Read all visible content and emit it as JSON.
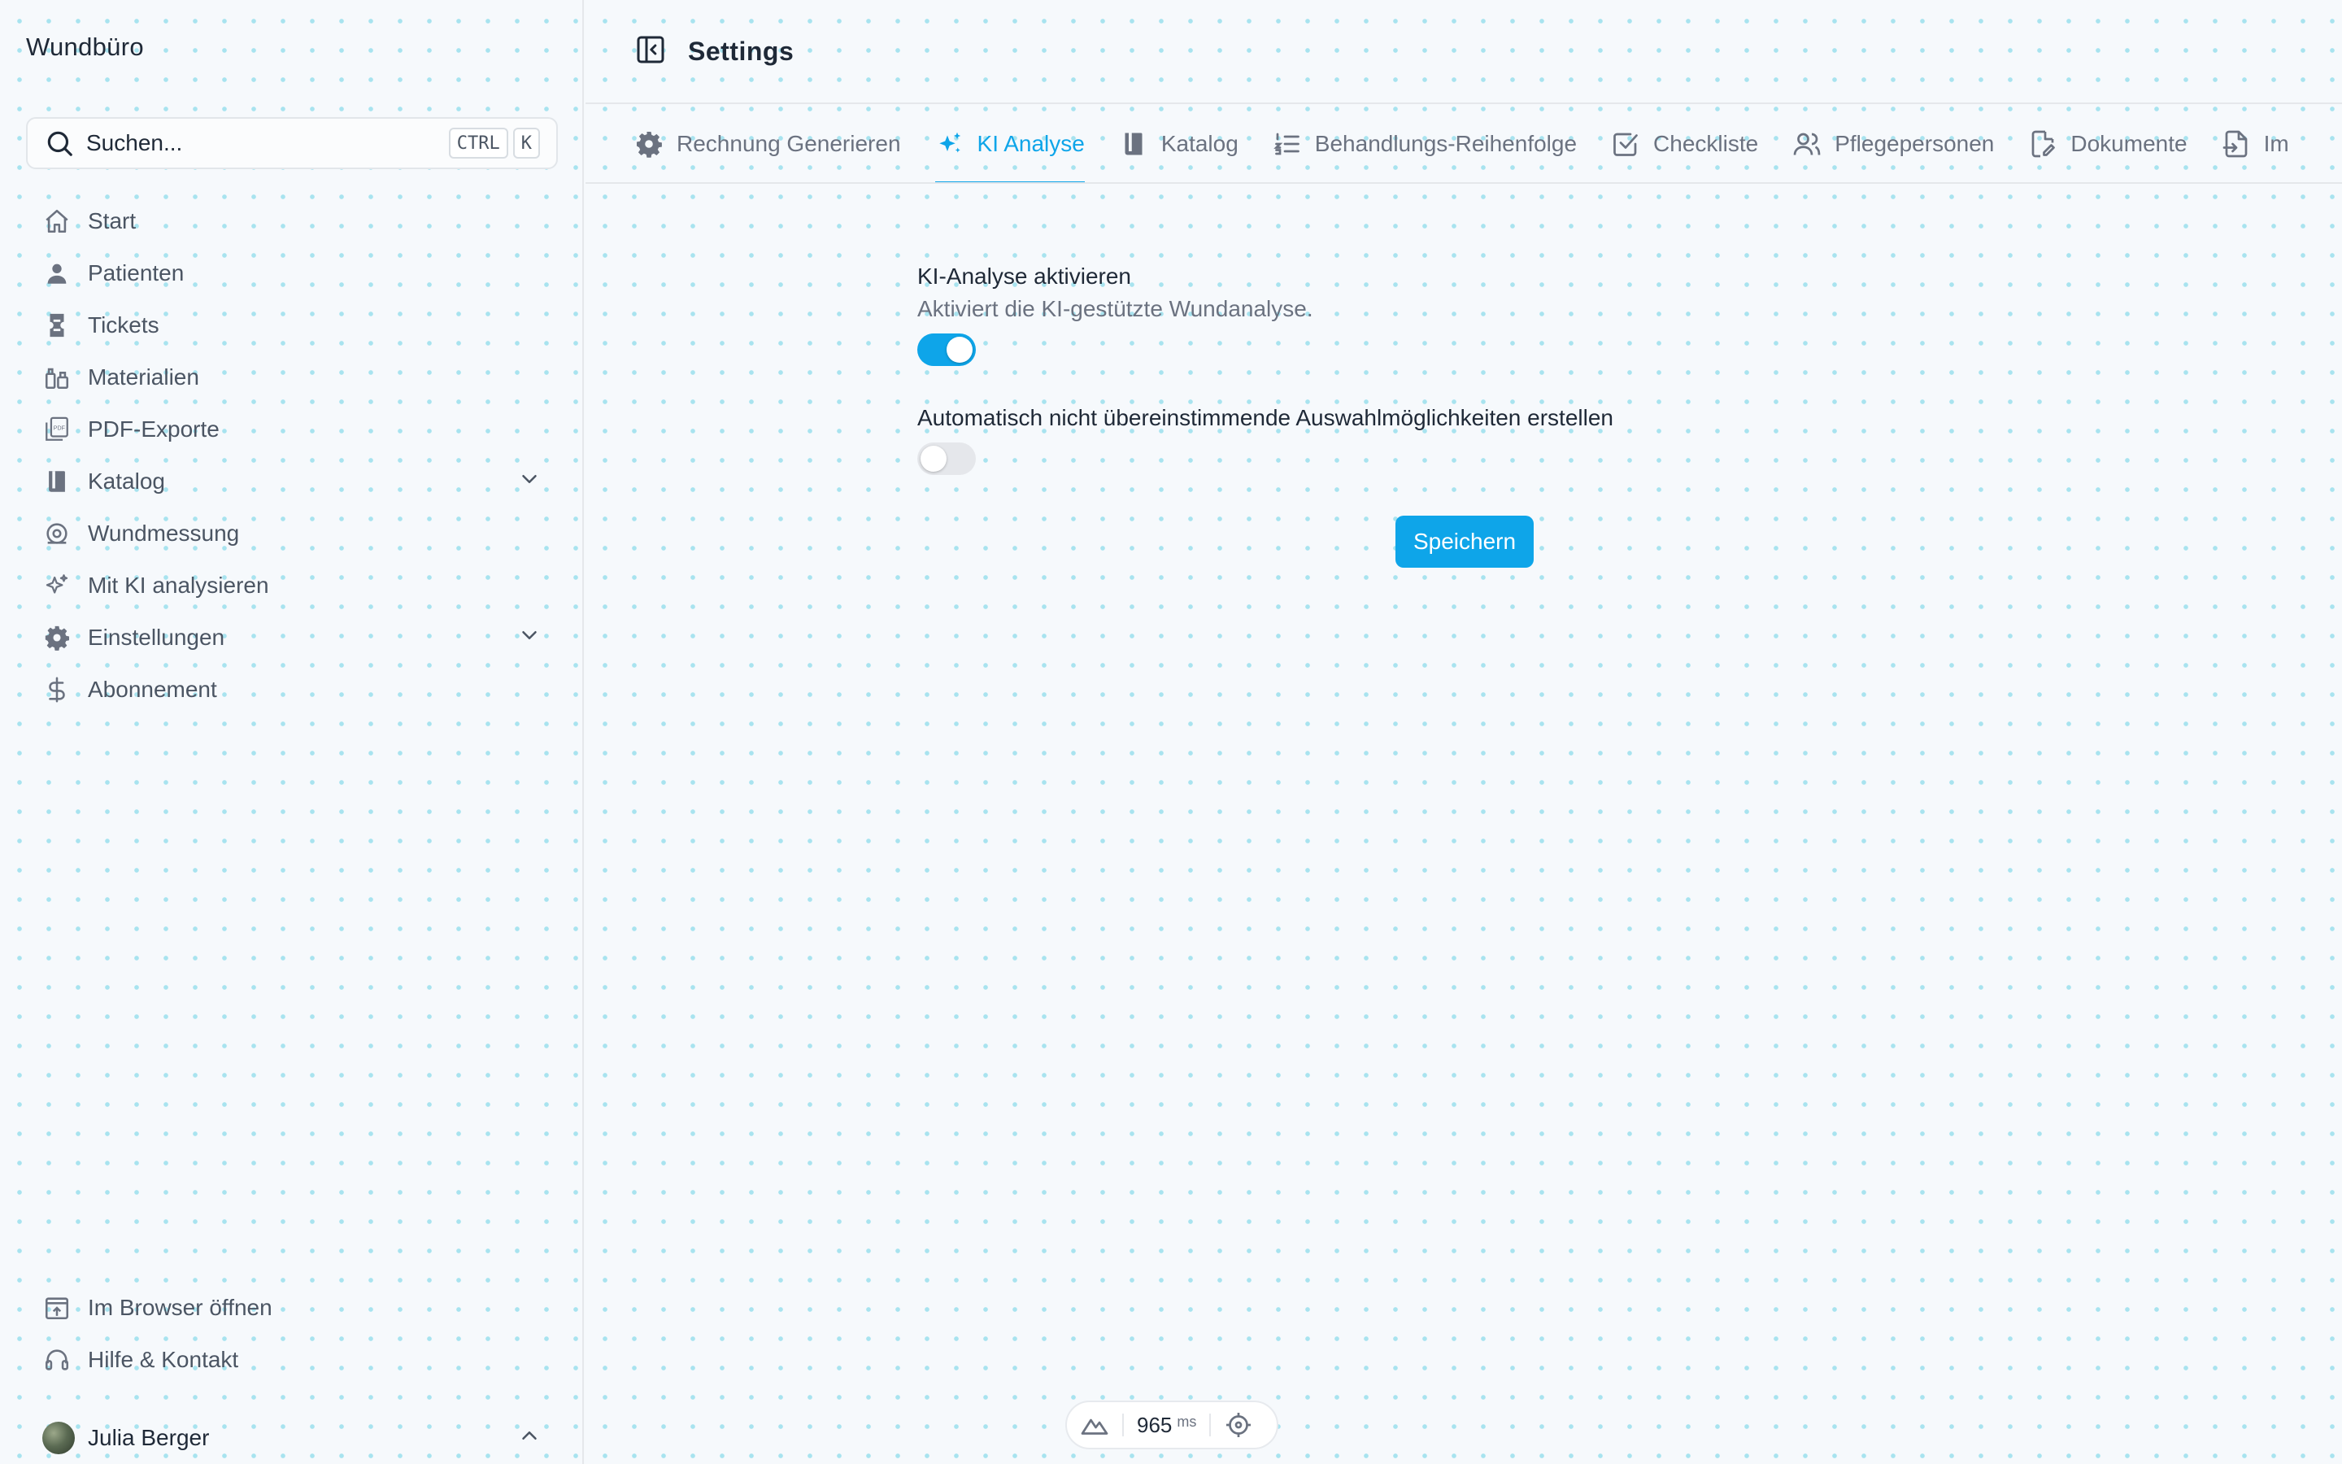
{
  "app": {
    "title": "Wundbüro"
  },
  "search": {
    "placeholder": "Suchen...",
    "kbd_ctrl": "CTRL",
    "kbd_k": "K"
  },
  "sidebar": {
    "items": [
      {
        "label": "Start",
        "icon": "home-icon"
      },
      {
        "label": "Patienten",
        "icon": "user-icon"
      },
      {
        "label": "Tickets",
        "icon": "ticket-icon"
      },
      {
        "label": "Materialien",
        "icon": "materials-icon"
      },
      {
        "label": "PDF-Exporte",
        "icon": "pdf-icon"
      },
      {
        "label": "Katalog",
        "icon": "book-icon",
        "expandable": true
      },
      {
        "label": "Wundmessung",
        "icon": "measure-icon"
      },
      {
        "label": "Mit KI analysieren",
        "icon": "sparkles-icon"
      },
      {
        "label": "Einstellungen",
        "icon": "gear-icon",
        "expandable": true
      },
      {
        "label": "Abonnement",
        "icon": "dollar-icon"
      }
    ],
    "bottom_items": [
      {
        "label": "Im Browser öffnen",
        "icon": "open-browser-icon"
      },
      {
        "label": "Hilfe & Kontakt",
        "icon": "headset-icon"
      }
    ],
    "user": {
      "name": "Julia Berger"
    }
  },
  "header": {
    "title": "Settings"
  },
  "tabs": [
    {
      "label": "Rechnung Generieren",
      "icon": "gear-icon",
      "active": false
    },
    {
      "label": "KI Analyse",
      "icon": "sparkles-icon",
      "active": true
    },
    {
      "label": "Katalog",
      "icon": "book-icon",
      "active": false
    },
    {
      "label": "Behandlungs-Reihenfolge",
      "icon": "ordered-list-icon",
      "active": false
    },
    {
      "label": "Checkliste",
      "icon": "checkbox-icon",
      "active": false
    },
    {
      "label": "Pflegepersonen",
      "icon": "users-icon",
      "active": false
    },
    {
      "label": "Dokumente",
      "icon": "document-edit-icon",
      "active": false
    },
    {
      "label": "Im",
      "icon": "import-icon",
      "active": false
    }
  ],
  "settings": {
    "ai_enable": {
      "title": "KI-Analyse aktivieren",
      "description": "Aktiviert die KI-gestützte Wundanalyse.",
      "enabled": true
    },
    "auto_create": {
      "title": "Automatisch nicht übereinstimmende Auswahlmöglichkeiten erstellen",
      "enabled": false
    },
    "save_label": "Speichern"
  },
  "perf": {
    "value": "965",
    "unit": "ms"
  },
  "colors": {
    "accent": "#0ea5e9",
    "text": "#1f2937",
    "muted": "#6b7280"
  }
}
